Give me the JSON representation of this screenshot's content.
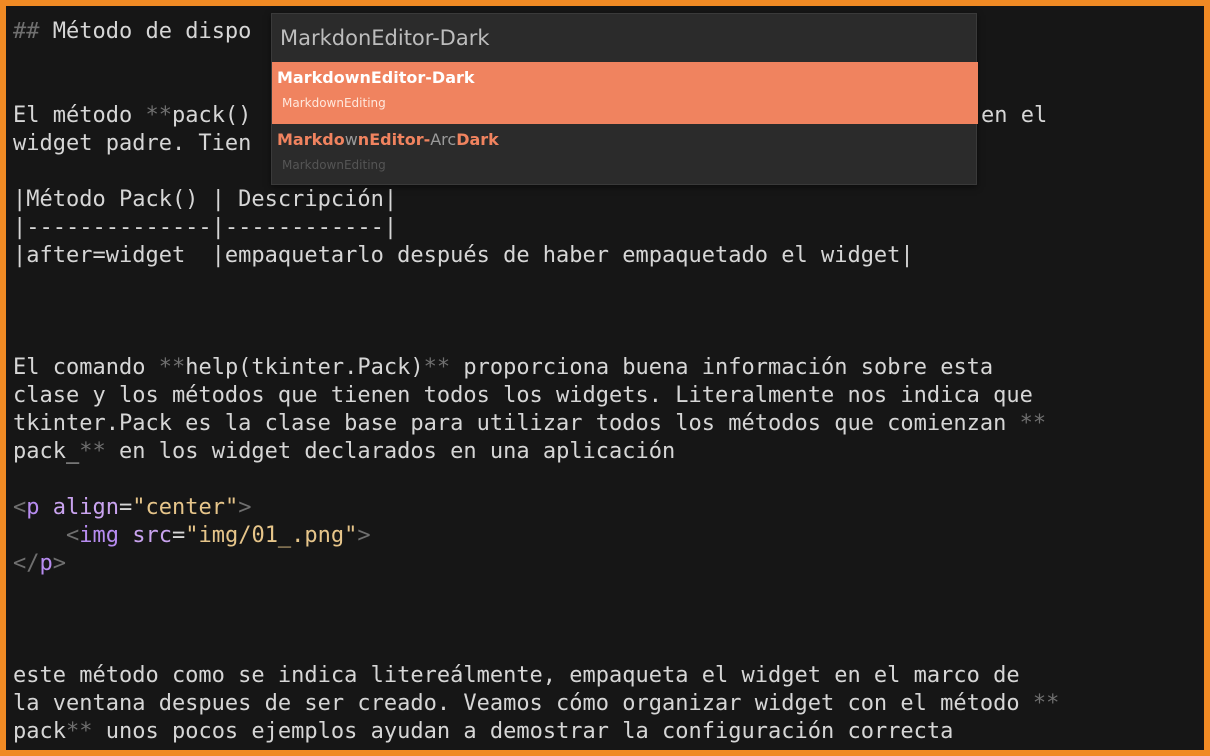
{
  "editor": {
    "lines": [
      {
        "parts": [
          {
            "t": "## ",
            "c": "dim"
          },
          {
            "t": "Método de dispo"
          }
        ]
      },
      {
        "parts": [
          {
            "t": "El método "
          },
          {
            "t": "**",
            "c": "dim"
          },
          {
            "t": "pack()"
          }
        ]
      },
      {
        "parts": [
          {
            "t": "widget padre. Tien"
          }
        ]
      },
      {
        "parts": [
          {
            "t": "|Método Pack() | Descripción|"
          }
        ]
      },
      {
        "parts": [
          {
            "t": "|--------------|------------|"
          }
        ]
      },
      {
        "parts": [
          {
            "t": "|after=widget  |empaquetarlo después de haber empaquetado el widget|"
          }
        ]
      },
      {
        "parts": [
          {
            "t": "El comando "
          },
          {
            "t": "**",
            "c": "dim"
          },
          {
            "t": "help(tkinter.Pack)"
          },
          {
            "t": "**",
            "c": "dim"
          },
          {
            "t": " proporciona buena información sobre esta"
          }
        ]
      },
      {
        "parts": [
          {
            "t": "clase y los métodos que tienen todos los widgets. Literalmente nos indica que"
          }
        ]
      },
      {
        "parts": [
          {
            "t": "tkinter.Pack es la clase base para utilizar todos los métodos que comienzan "
          },
          {
            "t": "**",
            "c": "dim"
          }
        ]
      },
      {
        "parts": [
          {
            "t": "pack_"
          },
          {
            "t": "**",
            "c": "dim"
          },
          {
            "t": " en los widget declarados en una aplicación"
          }
        ]
      },
      {
        "parts": [
          {
            "t": "<",
            "c": "dim"
          },
          {
            "t": "p",
            "c": "tag"
          },
          {
            "t": " align",
            "c": "attr"
          },
          {
            "t": "="
          },
          {
            "t": "\"center\"",
            "c": "str"
          },
          {
            "t": ">",
            "c": "dim"
          }
        ]
      },
      {
        "parts": [
          {
            "t": "    "
          },
          {
            "t": "<",
            "c": "dim"
          },
          {
            "t": "img",
            "c": "tag"
          },
          {
            "t": " src",
            "c": "attr"
          },
          {
            "t": "="
          },
          {
            "t": "\"img/01_.png\"",
            "c": "str"
          },
          {
            "t": ">",
            "c": "dim"
          }
        ]
      },
      {
        "parts": [
          {
            "t": "</",
            "c": "dim"
          },
          {
            "t": "p",
            "c": "tag"
          },
          {
            "t": ">",
            "c": "dim"
          }
        ]
      },
      {
        "parts": [
          {
            "t": "este método como se indica litereálmente, empaqueta el widget en el marco de"
          }
        ]
      },
      {
        "parts": [
          {
            "t": "la ventana despues de ser creado. Veamos cómo organizar widget con el método "
          },
          {
            "t": "**",
            "c": "dim"
          }
        ]
      },
      {
        "parts": [
          {
            "t": "pack"
          },
          {
            "t": "**",
            "c": "dim"
          },
          {
            "t": " unos pocos ejemplos ayudan a demostrar la configuración correcta"
          }
        ]
      }
    ],
    "line1_tail": "en el"
  },
  "palette": {
    "query": "MarkdonEditor-Dark",
    "items": [
      {
        "title": "MarkdownEditor-Dark",
        "subtitle": "MarkdownEditing"
      },
      {
        "title_parts": [
          {
            "t": "Markdo",
            "hl": true
          },
          {
            "t": "w"
          },
          {
            "t": "nEditor-",
            "hl": true
          },
          {
            "t": "Arc"
          },
          {
            "t": "Dark",
            "hl": true
          }
        ],
        "subtitle": "MarkdownEditing"
      }
    ]
  },
  "colors": {
    "frame": "#f08a24",
    "background": "#161616",
    "selection": "#f0835f"
  }
}
